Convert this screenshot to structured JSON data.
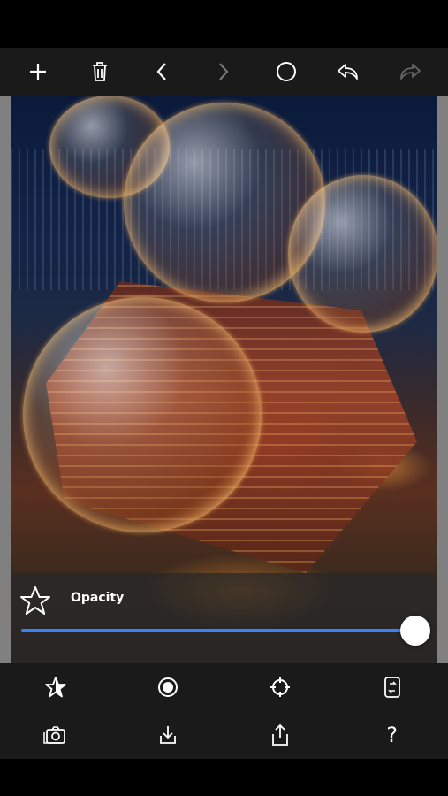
{
  "toolbar_top": {
    "add_icon": "plus-icon",
    "delete_icon": "trash-icon",
    "prev_icon": "chevron-left-icon",
    "next_icon": "chevron-right-icon",
    "circle_icon": "circle-icon",
    "undo_icon": "undo-icon",
    "redo_icon": "redo-icon"
  },
  "opacity_panel": {
    "label": "Opacity",
    "value": 1.0,
    "accent": "#3a82f7"
  },
  "toolbar_bottom": {
    "row1": [
      "favorite-star-icon",
      "record-icon",
      "target-icon",
      "swap-icon"
    ],
    "row2": [
      "camera-icon",
      "download-icon",
      "share-icon",
      "help-icon"
    ],
    "help_label": "?"
  }
}
